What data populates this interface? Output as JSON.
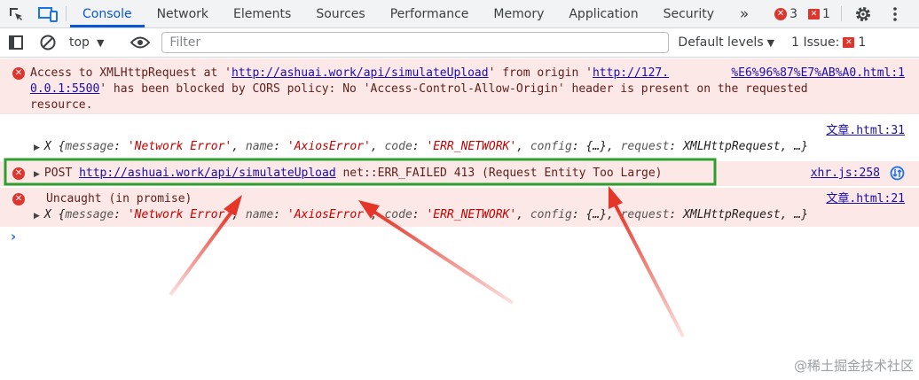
{
  "tabs": [
    "Console",
    "Network",
    "Elements",
    "Sources",
    "Performance",
    "Memory",
    "Application",
    "Security"
  ],
  "tab_more": "»",
  "error_count": "3",
  "issue_badge_count": "1",
  "toolbar": {
    "context": "top",
    "filter_placeholder": "Filter",
    "levels": "Default levels",
    "issues_label": "1 Issue:",
    "issues_count": "1"
  },
  "messages": {
    "cors": {
      "p1": "Access to XMLHttpRequest at '",
      "url1": "http://ashuai.work/api/simulateUpload",
      "p2": "' from origin '",
      "url2a": "http://127.",
      "url2b": "0.0.1:5500",
      "p3": "' has been blocked by CORS policy: No 'Access-Control-Allow-Origin' header is present on the requested",
      "p4": "resource.",
      "source": "%E6%96%87%E7%AB%A0.html:1"
    },
    "axios1": {
      "source": "文章.html:31",
      "prefix": "X {",
      "k1": "message",
      "v1": "'Network Error'",
      "k2": "name",
      "v2": "'AxiosError'",
      "k3": "code",
      "v3": "'ERR_NETWORK'",
      "k4": "config",
      "v4": "{…}",
      "k5": "request",
      "v5": "XMLHttpRequest",
      "suffix": "…}"
    },
    "post": {
      "method": "POST",
      "url": "http://ashuai.work/api/simulateUpload",
      "error": "net::ERR_FAILED 413 (Request Entity Too Large)",
      "source": "xhr.js:258"
    },
    "uncaught": {
      "text": "Uncaught (in promise)",
      "source": "文章.html:21",
      "prefix": "X {",
      "k1": "message",
      "v1": "'Network Error'",
      "k2": "name",
      "v2": "'AxiosError'",
      "k3": "code",
      "v3": "'ERR_NETWORK'",
      "k4": "config",
      "v4": "{…}",
      "k5": "request",
      "v5": "XMLHttpRequest",
      "suffix": "…}"
    }
  },
  "prompt": "›",
  "watermark": "@稀土掘金技术社区",
  "colors": {
    "accent": "#0b57d0",
    "error_red": "#dc362e",
    "error_bg": "#fce8e6",
    "highlight_green": "#2e9e2e",
    "arrow_red": "#e53528"
  }
}
